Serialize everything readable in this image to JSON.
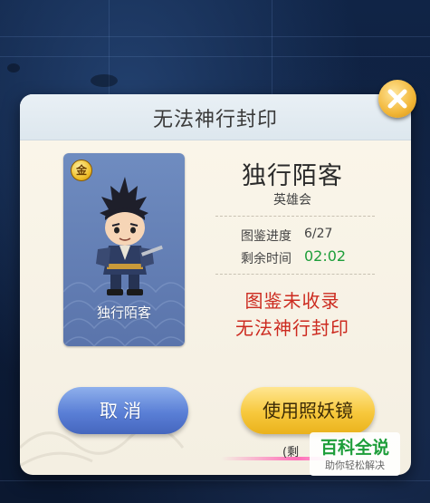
{
  "dialog": {
    "title": "无法神行封印"
  },
  "hero": {
    "badge": "金",
    "card_name": "独行陌客",
    "name": "独行陌客",
    "group": "英雄会"
  },
  "info": {
    "progress_label": "图鉴进度",
    "progress_value": "6/27",
    "time_label": "剩余时间",
    "time_value": "02:02"
  },
  "warning": {
    "line1": "图鉴未收录",
    "line2": "无法神行封印"
  },
  "buttons": {
    "cancel": "取消",
    "use_mirror": "使用照妖镜"
  },
  "overlay": {
    "partial_text": "(剩",
    "watermark_title": "百科全说",
    "watermark_sub": "助你轻松解决"
  },
  "colors": {
    "accent_green": "#1e9e3a",
    "warning_red": "#cc2a1f",
    "cancel_blue": "#5a7fd6",
    "mirror_gold": "#f7c83c"
  },
  "icons": [
    "close-icon",
    "gold-badge-icon",
    "hero-portrait"
  ]
}
